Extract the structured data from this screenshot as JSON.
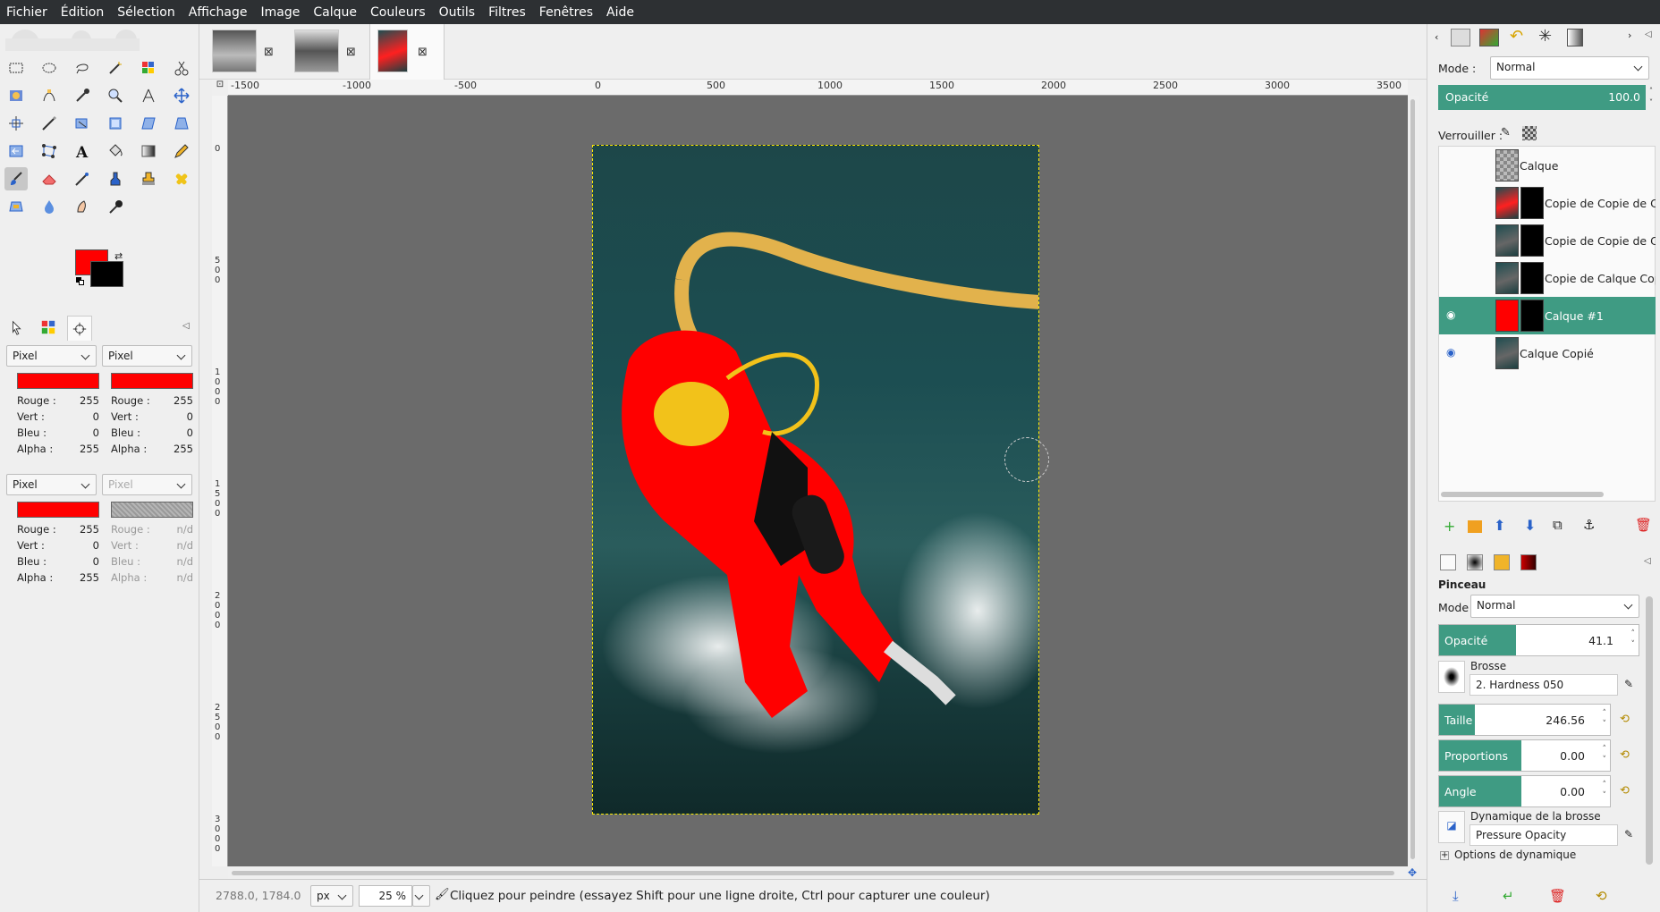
{
  "menu": [
    "Fichier",
    "Édition",
    "Sélection",
    "Affichage",
    "Image",
    "Calque",
    "Couleurs",
    "Outils",
    "Filtres",
    "Fenêtres",
    "Aide"
  ],
  "colors": {
    "foreground": "#ff0000",
    "background": "#000000",
    "accent": "#3f9b83"
  },
  "pointer_info": {
    "group1": {
      "left": {
        "mode": "Pixel",
        "swatch": "#ff0000",
        "rows": [
          {
            "label": "Rouge :",
            "value": "255"
          },
          {
            "label": "Vert :",
            "value": "0"
          },
          {
            "label": "Bleu :",
            "value": "0"
          },
          {
            "label": "Alpha :",
            "value": "255"
          }
        ]
      },
      "right": {
        "mode": "Pixel",
        "swatch": "#ff0000",
        "rows": [
          {
            "label": "Rouge :",
            "value": "255"
          },
          {
            "label": "Vert :",
            "value": "0"
          },
          {
            "label": "Bleu :",
            "value": "0"
          },
          {
            "label": "Alpha :",
            "value": "255"
          }
        ]
      }
    },
    "group2": {
      "left": {
        "mode": "Pixel",
        "swatch": "#ff0000",
        "rows": [
          {
            "label": "Rouge :",
            "value": "255"
          },
          {
            "label": "Vert :",
            "value": "0"
          },
          {
            "label": "Bleu :",
            "value": "0"
          },
          {
            "label": "Alpha :",
            "value": "255"
          }
        ]
      },
      "right": {
        "mode": "Pixel",
        "swatch": "#9a9a9a",
        "rows": [
          {
            "label": "Rouge :",
            "value": "n/d"
          },
          {
            "label": "Vert :",
            "value": "n/d"
          },
          {
            "label": "Bleu :",
            "value": "n/d"
          },
          {
            "label": "Alpha :",
            "value": "n/d"
          }
        ]
      }
    }
  },
  "ruler": {
    "h_ticks": [
      "-1500",
      "-1000",
      "-500",
      "0",
      "500",
      "1000",
      "1500",
      "2000",
      "2500",
      "3000",
      "3500"
    ],
    "v_ticks": [
      "0",
      "500",
      "1000",
      "1500",
      "2000",
      "2500",
      "3000"
    ]
  },
  "status": {
    "coords": "2788.0, 1784.0",
    "unit": "px",
    "zoom": "25 %",
    "message": "Cliquez pour peindre (essayez Shift pour une ligne droite, Ctrl pour capturer une couleur)"
  },
  "layers_panel": {
    "mode_label": "Mode :",
    "mode": "Normal",
    "opacity_label": "Opacité",
    "opacity": "100.0",
    "lock_label": "Verrouiller :",
    "layers": [
      {
        "name": "Calque",
        "visible": false,
        "selected": false
      },
      {
        "name": "Copie de Copie de Calque",
        "visible": false,
        "selected": false
      },
      {
        "name": "Copie de Copie de Calque",
        "visible": false,
        "selected": false
      },
      {
        "name": "Copie de Calque Copié",
        "visible": false,
        "selected": false
      },
      {
        "name": "Calque #1",
        "visible": true,
        "selected": true
      },
      {
        "name": "Calque Copié",
        "visible": true,
        "selected": false
      }
    ]
  },
  "tool_options": {
    "title": "Pinceau",
    "mode_label": "Mode :",
    "mode": "Normal",
    "opacity_label": "Opacité",
    "opacity": "41.1",
    "brush_label": "Brosse",
    "brush": "2. Hardness 050",
    "size_label": "Taille",
    "size": "246.56",
    "aspect_label": "Proportions",
    "aspect": "0.00",
    "angle_label": "Angle",
    "angle": "0.00",
    "dynamics_label": "Dynamique de la brosse",
    "dynamics": "Pressure Opacity",
    "dyn_options_label": "Options de dynamique"
  }
}
